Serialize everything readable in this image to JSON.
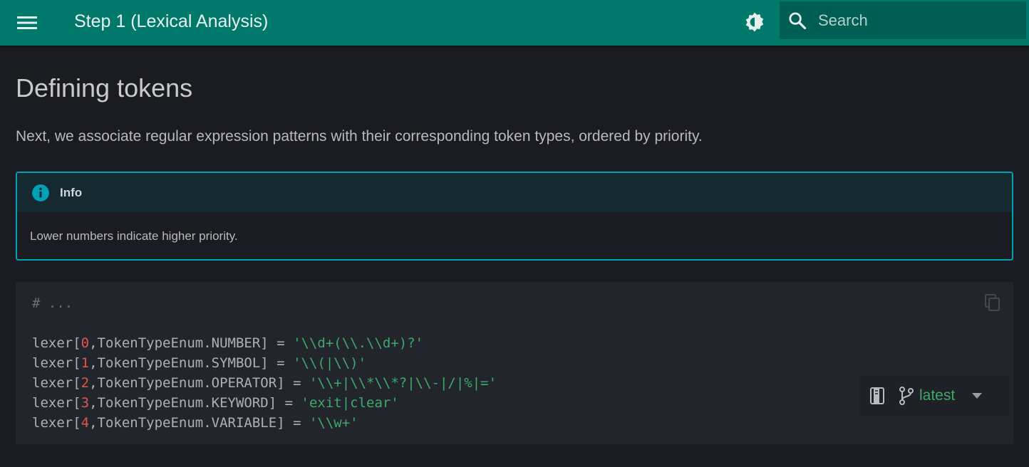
{
  "header": {
    "title": "Step 1 (Lexical Analysis)",
    "search_placeholder": "Search"
  },
  "page": {
    "title": "Defining tokens",
    "intro": "Next, we associate regular expression patterns with their corresponding token types, ordered by priority."
  },
  "admonition": {
    "type": "info",
    "title": "Info",
    "body": "Lower numbers indicate higher priority."
  },
  "code": {
    "comment": "# ...",
    "lines": [
      {
        "prefix": "lexer[",
        "index": "0",
        "middle": ",TokenTypeEnum.NUMBER] = ",
        "pattern": "'\\\\d+(\\\\.\\\\d+)?'"
      },
      {
        "prefix": "lexer[",
        "index": "1",
        "middle": ",TokenTypeEnum.SYMBOL] = ",
        "pattern": "'\\\\(|\\\\)'"
      },
      {
        "prefix": "lexer[",
        "index": "2",
        "middle": ",TokenTypeEnum.OPERATOR] = ",
        "pattern": "'\\\\+|\\\\*\\\\*?|\\\\-|/|%|='"
      },
      {
        "prefix": "lexer[",
        "index": "3",
        "middle": ",TokenTypeEnum.KEYWORD] = ",
        "pattern": "'exit|clear'"
      },
      {
        "prefix": "lexer[",
        "index": "4",
        "middle": ",TokenTypeEnum.VARIABLE] = ",
        "pattern": "'\\\\w+'"
      }
    ]
  },
  "version": {
    "label": "latest"
  },
  "colors": {
    "header_bg": "#00796b",
    "accent_cyan": "#00a2b8",
    "string_green": "#3fa86b",
    "number_red": "#e0564f"
  }
}
